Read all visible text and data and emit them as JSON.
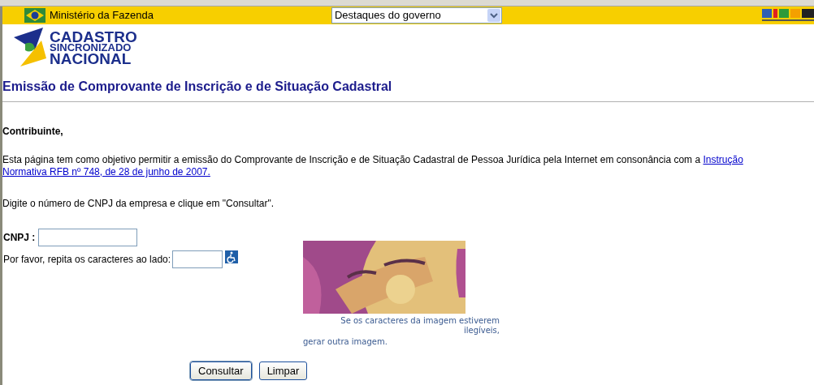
{
  "top_bar": {
    "ministry": "Ministério da Fazenda",
    "dropdown": {
      "value": "Destaques do governo"
    }
  },
  "logo": {
    "lines": [
      "CADASTRO",
      "SINCRONIZADO",
      "NACIONAL"
    ]
  },
  "title": "Emissão de Comprovante de Inscrição e de Situação Cadastral",
  "greeting": "Contribuinte,",
  "intro": {
    "text": "Esta página tem como objetivo permitir a emissão do Comprovante de Inscrição e de Situação Cadastral de Pessoa Jurídica pela Internet em consonância com a ",
    "link_lines": [
      "Instrução",
      "Normativa RFB nº 748, de 28 de junho de 2007."
    ]
  },
  "instruction": "Digite o número de CNPJ da empresa e clique em \"Consultar\".",
  "form": {
    "cnpj_label": "CNPJ :",
    "captcha_label": "Por favor, repita os caracteres ao lado:"
  },
  "captcha": {
    "kind": "picture",
    "note": "Se os caracteres da imagem estiverem ilegíveis,",
    "link": "gerar outra imagem."
  },
  "buttons": [
    "Consultar",
    "Limpar"
  ]
}
